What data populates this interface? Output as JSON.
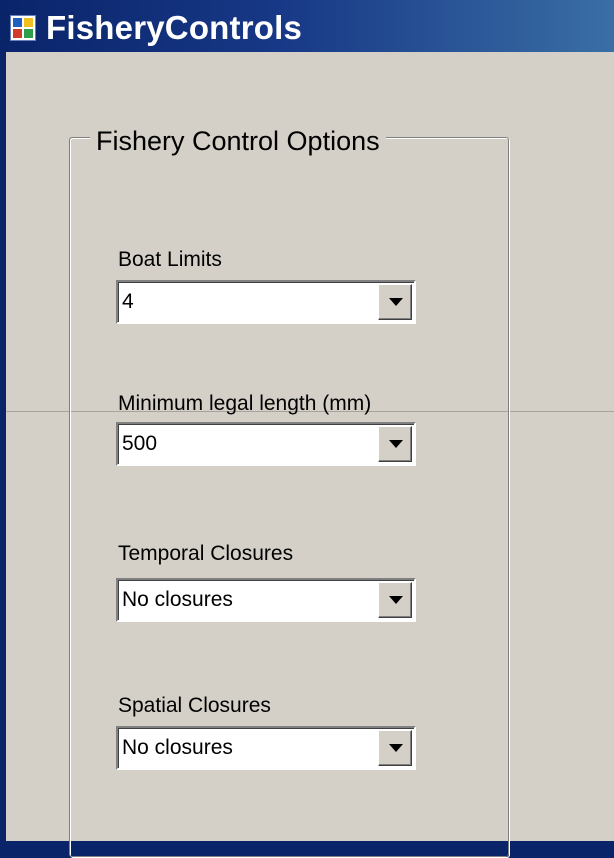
{
  "window": {
    "title": "FisheryControls",
    "icon": "app-window-icon"
  },
  "group": {
    "legend": "Fishery Control Options"
  },
  "fields": [
    {
      "label": "Boat Limits",
      "value": "4"
    },
    {
      "label": "Minimum legal length (mm)",
      "value": "500"
    },
    {
      "label": "Temporal Closures",
      "value": "No closures"
    },
    {
      "label": "Spatial Closures",
      "value": "No closures"
    }
  ],
  "icons": {
    "dropdown": "chevron-down-icon"
  },
  "colors": {
    "titlebar": "#0a246a",
    "form_background": "#d4d0c8",
    "input_background": "#ffffff"
  }
}
